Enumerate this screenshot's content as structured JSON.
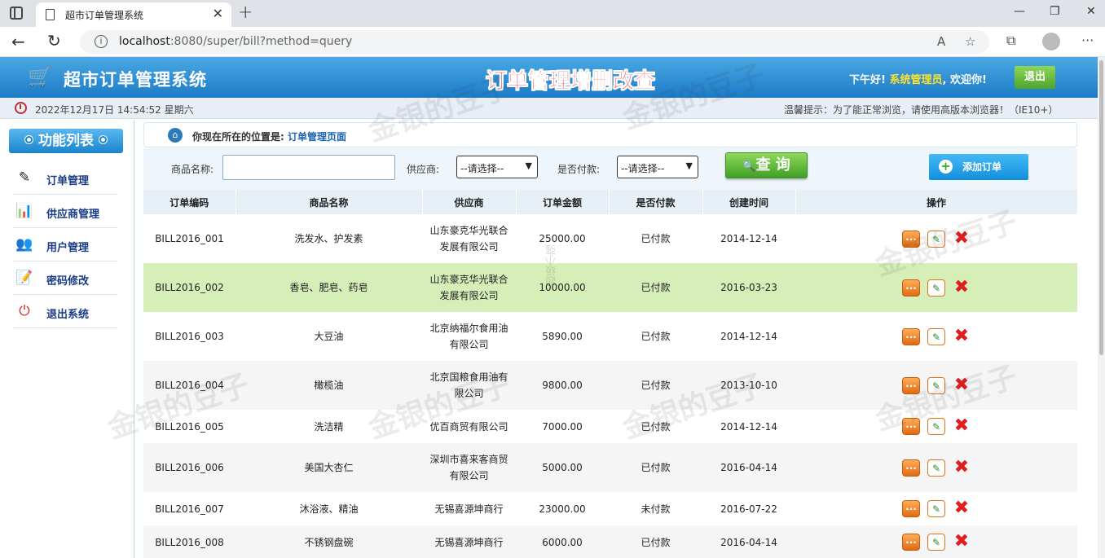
{
  "browser": {
    "tab_title": "超市订单管理系统",
    "url_host": "localhost",
    "url_rest": ":8080/super/bill?method=query"
  },
  "header": {
    "system_title": "超市订单管理系统",
    "banner": "订单管理增删改查",
    "greeting_prefix": "下午好! ",
    "username": "系统管理员",
    "greeting_suffix": ", 欢迎你!",
    "logout_label": "退出"
  },
  "timebar": {
    "datetime": "2022年12月17日 14:54:52 星期六",
    "tip": "温馨提示：为了能正常浏览，请使用高版本浏览器！（IE10+）"
  },
  "sidebar": {
    "title": "功能列表",
    "items": [
      {
        "label": "订单管理",
        "icon": "order-icon"
      },
      {
        "label": "供应商管理",
        "icon": "provider-icon"
      },
      {
        "label": "用户管理",
        "icon": "users-icon"
      },
      {
        "label": "密码修改",
        "icon": "password-icon"
      },
      {
        "label": "退出系统",
        "icon": "exit-icon"
      }
    ]
  },
  "location": {
    "prefix": "你现在所在的位置是: ",
    "value": "订单管理页面"
  },
  "search": {
    "product_label": "商品名称:",
    "product_value": "",
    "provider_label": "供应商:",
    "provider_selected": "--请选择--",
    "payment_label": "是否付款:",
    "payment_selected": "--请选择--",
    "query_label": "查 询",
    "add_label": "添加订单"
  },
  "table": {
    "headers": [
      "订单编码",
      "商品名称",
      "供应商",
      "订单金额",
      "是否付款",
      "创建时间",
      "操作"
    ],
    "rows": [
      [
        "BILL2016_001",
        "洗发水、护发素",
        "山东豪克华光联合发展有限公司",
        "25000.00",
        "已付款",
        "2014-12-14"
      ],
      [
        "BILL2016_002",
        "香皂、肥皂、药皂",
        "山东豪克华光联合发展有限公司",
        "10000.00",
        "已付款",
        "2016-03-23"
      ],
      [
        "BILL2016_003",
        "大豆油",
        "北京纳福尔食用油有限公司",
        "5890.00",
        "已付款",
        "2014-12-14"
      ],
      [
        "BILL2016_004",
        "橄榄油",
        "北京国粮食用油有限公司",
        "9800.00",
        "已付款",
        "2013-10-10"
      ],
      [
        "BILL2016_005",
        "洗洁精",
        "优百商贸有限公司",
        "7000.00",
        "已付款",
        "2014-12-14"
      ],
      [
        "BILL2016_006",
        "美国大杏仁",
        "深圳市喜来客商贸有限公司",
        "5000.00",
        "已付款",
        "2016-04-14"
      ],
      [
        "BILL2016_007",
        "沐浴液、精油",
        "无锡喜源坤商行",
        "23000.00",
        "未付款",
        "2016-07-22"
      ],
      [
        "BILL2016_008",
        "不锈钢盘碗",
        "无锡喜源坤商行",
        "6000.00",
        "已付款",
        "2016-04-14"
      ]
    ]
  },
  "watermark": {
    "text": "金银的豆子",
    "vertical": "超级小强"
  }
}
